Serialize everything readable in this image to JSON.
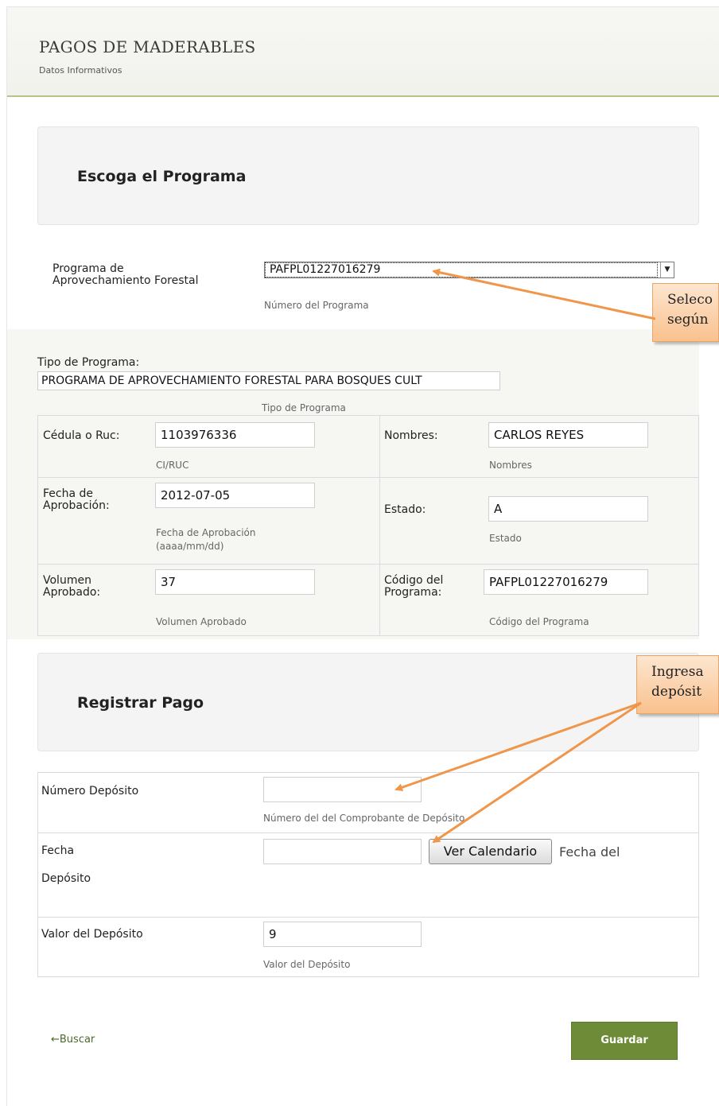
{
  "header": {
    "title": "PAGOS DE MADERABLES",
    "subtitle": "Datos Informativos"
  },
  "programa_section": {
    "title": "Escoga el Programa",
    "label": "Programa de Aprovechamiento Forestal",
    "selected_value": "PAFPL01227016279",
    "help": "Número del Programa"
  },
  "tipo_programa": {
    "label": "Tipo de Programa:",
    "value": "PROGRAMA DE APROVECHAMIENTO FORESTAL PARA BOSQUES CULT",
    "help": "Tipo de Programa"
  },
  "details": {
    "cedula": {
      "label": "Cédula o Ruc:",
      "value": "1103976336",
      "help": "CI/RUC"
    },
    "nombres": {
      "label": "Nombres:",
      "value": "CARLOS REYES",
      "help": "Nombres"
    },
    "fecha_aprobacion": {
      "label": "Fecha de Aprobación:",
      "value": "2012-07-05",
      "help": "Fecha de Aprobación (aaaa/mm/dd)"
    },
    "estado": {
      "label": "Estado:",
      "value": "A",
      "help": "Estado"
    },
    "volumen": {
      "label": "Volumen Aprobado:",
      "value": "37",
      "help": "Volumen Aprobado"
    },
    "codigo": {
      "label": "Código del Programa:",
      "value": "PAFPL01227016279",
      "help": "Código del Programa"
    }
  },
  "pago_section": {
    "title": "Registrar Pago",
    "numero_deposito": {
      "label": "Número Depósito",
      "value": "",
      "help": "Número del del Comprobante de Depósito"
    },
    "fecha_deposito": {
      "label_line1": "Fecha",
      "label_line2": "Depósito",
      "value": "",
      "button": "Ver Calendario",
      "help": "Fecha del"
    },
    "valor_deposito": {
      "label": "Valor del Depósito",
      "value": "9",
      "help": "Valor del Depósito"
    }
  },
  "callouts": {
    "callout1": {
      "line1": "Seleco",
      "line2": "según"
    },
    "callout2": {
      "line1": "Ingresa",
      "line2": "depósit"
    }
  },
  "actions": {
    "back_link": "←Buscar",
    "save_button": "Guardar"
  },
  "colors": {
    "accent": "#6e8c38",
    "callout": "#f9c18e",
    "arrow": "#f0964a"
  }
}
